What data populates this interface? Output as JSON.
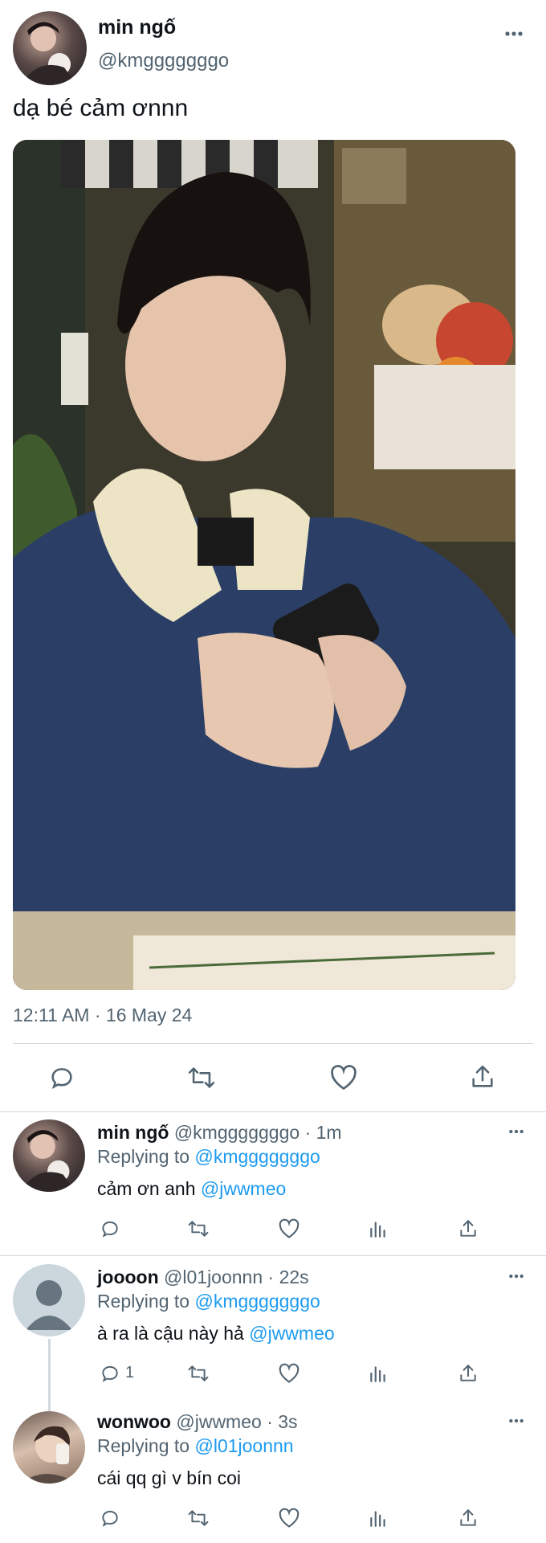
{
  "main_tweet": {
    "author_name": "min ngố",
    "author_handle": "@kmgggggggo",
    "text": "dạ bé cảm ơnnn",
    "timestamp": "12:11 AM · 16 May 24",
    "more_icon": "more-horizontal-icon"
  },
  "actions": {
    "reply_icon": "reply-icon",
    "retweet_icon": "retweet-icon",
    "like_icon": "heart-icon",
    "share_icon": "share-icon",
    "views_icon": "views-icon"
  },
  "replies": [
    {
      "name": "min ngố",
      "handle": "@kmgggggggo",
      "time": "· 1m",
      "replying_prefix": "Replying to",
      "replying_to": "@kmgggggggo",
      "text": "cảm ơn anh",
      "mention": "@jwwmeo",
      "reply_count": ""
    },
    {
      "name": "joooon",
      "handle": "@l01joonnn",
      "time": "· 22s",
      "replying_prefix": "Replying to",
      "replying_to": "@kmgggggggo",
      "text": "à ra là cậu này hả",
      "mention": "@jwwmeo",
      "reply_count": "1"
    },
    {
      "name": "wonwoo",
      "handle": "@jwwmeo",
      "time": "· 3s",
      "replying_prefix": "Replying to",
      "replying_to": "@l01joonnn",
      "text": "cái qq gì v bín coi",
      "mention": "",
      "reply_count": ""
    }
  ],
  "colors": {
    "accent": "#1d9bf0",
    "text": "#0f1419",
    "secondary": "#536471",
    "divider": "#cfd9de"
  }
}
